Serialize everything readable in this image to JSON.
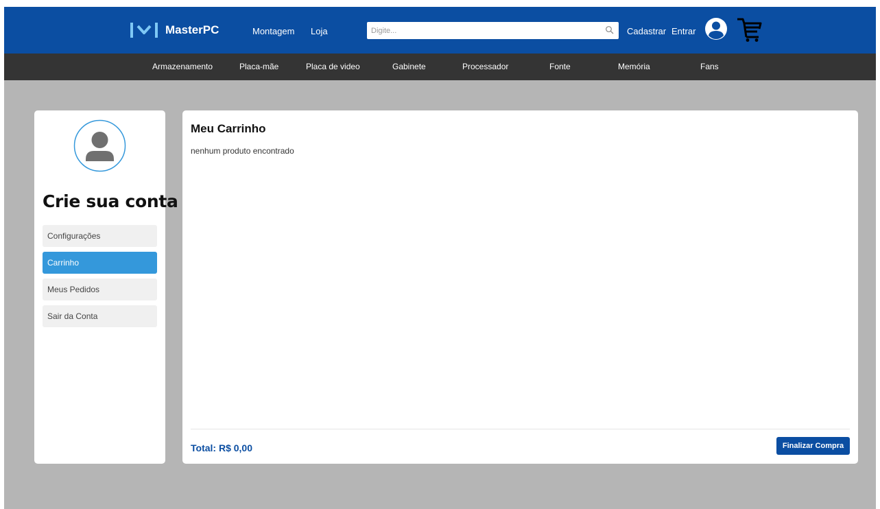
{
  "header": {
    "brand": "MasterPC",
    "nav": [
      "Montagem",
      "Loja"
    ],
    "search_placeholder": "Digite...",
    "signup_label": "Cadastrar",
    "login_label": "Entrar",
    "icons": [
      "logo-icon",
      "search-icon",
      "user-icon",
      "cart-icon"
    ]
  },
  "categories": [
    "Armazenamento",
    "Placa-mãe",
    "Placa de video",
    "Gabinete",
    "Processador",
    "Fonte",
    "Memória",
    "Fans"
  ],
  "sidebar": {
    "title": "Crie sua conta",
    "items": [
      {
        "label": "Configurações",
        "active": false
      },
      {
        "label": "Carrinho",
        "active": true
      },
      {
        "label": "Meus Pedidos",
        "active": false
      },
      {
        "label": "Sair da Conta",
        "active": false
      }
    ]
  },
  "cart": {
    "title": "Meu Carrinho",
    "empty_message": "nenhum produto encontrado",
    "total_label": "Total: R$",
    "total_value": "0,00",
    "checkout_label": "Finalizar Compra"
  },
  "colors": {
    "header": "#0b4ea2",
    "category_bar": "#343434",
    "background": "#b5b5b5",
    "active_item": "#3498db",
    "accent": "#0b4ea2"
  }
}
